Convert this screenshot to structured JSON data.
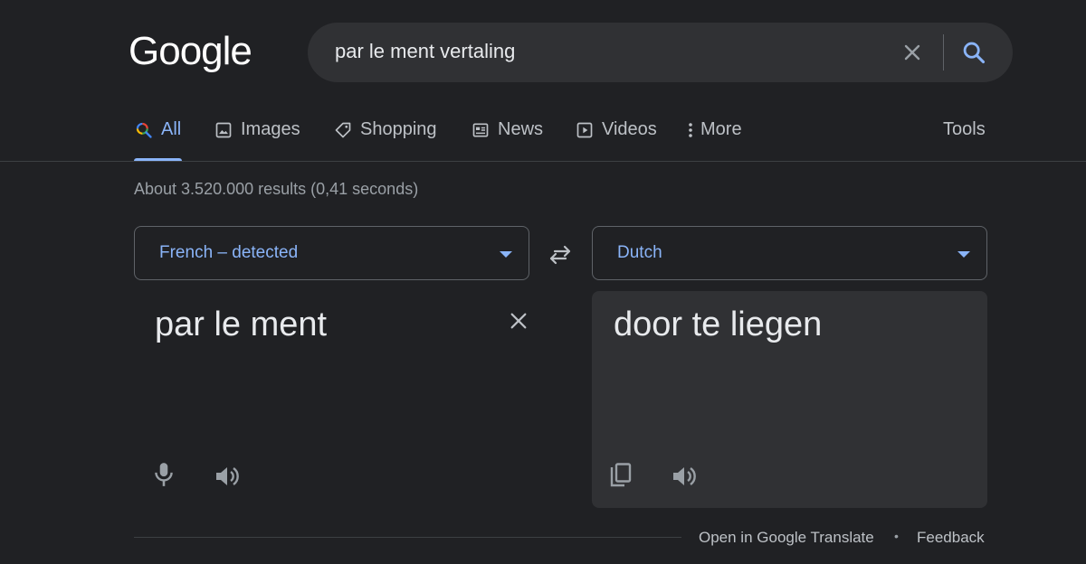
{
  "header": {
    "logo_text": "Google",
    "query": "par le ment vertaling"
  },
  "tabs": [
    {
      "label": "All",
      "icon": "search-icon"
    },
    {
      "label": "Images",
      "icon": "image-icon"
    },
    {
      "label": "Shopping",
      "icon": "tag-icon"
    },
    {
      "label": "News",
      "icon": "news-icon"
    },
    {
      "label": "Videos",
      "icon": "play-icon"
    },
    {
      "label": "More",
      "icon": "more-vert-icon"
    }
  ],
  "tools_label": "Tools",
  "result_stats": "About 3.520.000 results (0,41 seconds)",
  "translate": {
    "source_language": "French – detected",
    "target_language": "Dutch",
    "source_text": "par le ment",
    "target_text": "door te liegen"
  },
  "footer": {
    "open_link": "Open in Google Translate",
    "separator": "•",
    "feedback_link": "Feedback"
  },
  "colors": {
    "background": "#202124",
    "accent": "#8ab4f8",
    "text": "#e8eaed",
    "muted": "#bdc1c6",
    "panel": "#303134"
  }
}
